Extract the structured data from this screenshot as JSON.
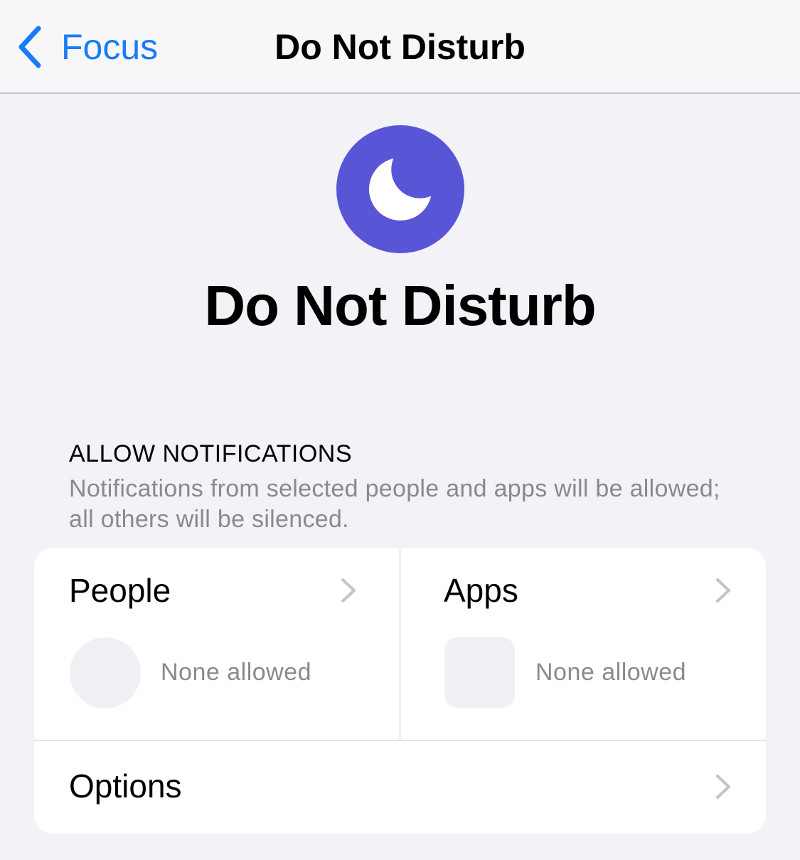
{
  "nav": {
    "back_label": "Focus",
    "title": "Do Not Disturb",
    "back_icon": "chevron-left-icon",
    "accent_color": "#1a7cf5"
  },
  "hero": {
    "icon": "moon-icon",
    "icon_background": "#5856d6",
    "title": "Do Not Disturb"
  },
  "allow_notifications": {
    "header": "ALLOW NOTIFICATIONS",
    "footer": "Notifications from selected people and apps will be allowed; all others will be silenced."
  },
  "cards": {
    "people": {
      "label": "People",
      "status": "None allowed"
    },
    "apps": {
      "label": "Apps",
      "status": "None allowed"
    },
    "options": {
      "label": "Options"
    }
  }
}
